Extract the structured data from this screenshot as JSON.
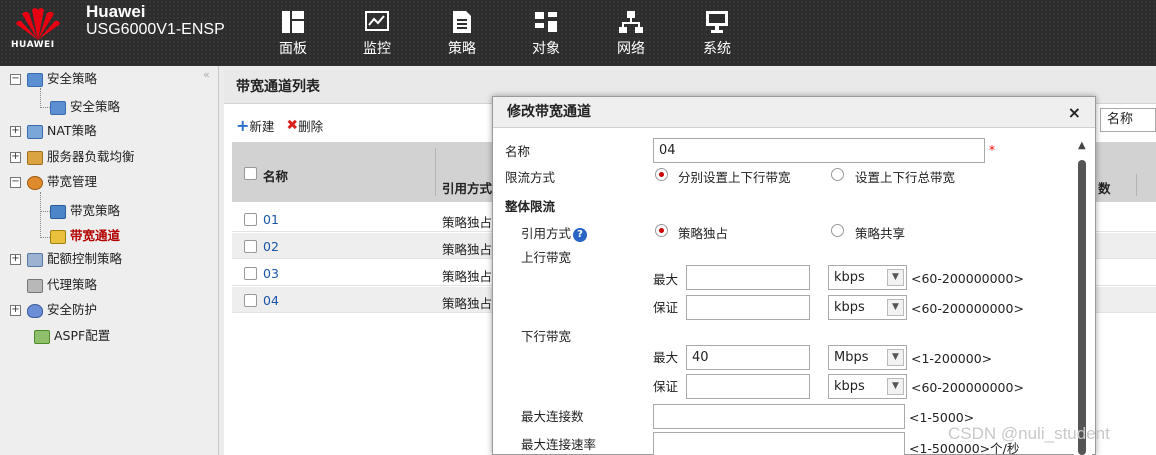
{
  "header": {
    "logo_text": "HUAWEI",
    "brand_name": "Huawei",
    "device_model": "USG6000V1-ENSP",
    "nav": [
      {
        "label": "面板",
        "icon": "dashboard-icon"
      },
      {
        "label": "监控",
        "icon": "monitor-icon"
      },
      {
        "label": "策略",
        "icon": "policy-icon"
      },
      {
        "label": "对象",
        "icon": "object-icon"
      },
      {
        "label": "网络",
        "icon": "network-icon"
      },
      {
        "label": "系统",
        "icon": "system-icon"
      }
    ]
  },
  "sidebar": {
    "collapse_glyph": "«",
    "items": [
      {
        "label": "安全策略",
        "expand": "−"
      },
      {
        "label": "安全策略"
      },
      {
        "label": "NAT策略",
        "expand": "+"
      },
      {
        "label": "服务器负载均衡",
        "expand": "+"
      },
      {
        "label": "带宽管理",
        "expand": "−"
      },
      {
        "label": "带宽策略"
      },
      {
        "label": "带宽通道"
      },
      {
        "label": "配额控制策略",
        "expand": "+"
      },
      {
        "label": "代理策略"
      },
      {
        "label": "安全防护",
        "expand": "+"
      },
      {
        "label": "ASPF配置"
      }
    ]
  },
  "main": {
    "title": "带宽通道列表",
    "new_label": "新建",
    "delete_label": "删除",
    "columns": [
      "名称",
      "引用方式"
    ],
    "rows": [
      {
        "name": "01",
        "ref": "策略独占"
      },
      {
        "name": "02",
        "ref": "策略独占"
      },
      {
        "name": "03",
        "ref": "策略独占"
      },
      {
        "name": "04",
        "ref": "策略独占"
      }
    ],
    "right_partial_col": "数",
    "search_field_label": "名称"
  },
  "dialog": {
    "title": "修改带宽通道",
    "close": "×",
    "name_label": "名称",
    "name_value": "04",
    "required_mark": "*",
    "limit_mode_label": "限流方式",
    "limit_mode_options": [
      "分别设置上下行带宽",
      "设置上下行总带宽"
    ],
    "limit_mode_selected": 0,
    "section_overall": "整体限流",
    "ref_mode_label": "引用方式",
    "ref_mode_help": "?",
    "ref_mode_options": [
      "策略独占",
      "策略共享"
    ],
    "ref_mode_selected": 0,
    "upstream_label": "上行带宽",
    "downstream_label": "下行带宽",
    "max_label": "最大",
    "guarantee_label": "保证",
    "up_max": {
      "value": "",
      "unit": "kbps",
      "range": "<60-200000000>"
    },
    "up_guarantee": {
      "value": "",
      "unit": "kbps",
      "range": "<60-200000000>"
    },
    "down_max": {
      "value": "40",
      "unit": "Mbps",
      "range": "<1-200000>"
    },
    "down_guarantee": {
      "value": "",
      "unit": "kbps",
      "range": "<60-200000000>"
    },
    "max_conn_label": "最大连接数",
    "max_conn_value": "",
    "max_conn_range": "<1-5000>",
    "max_conn_rate_label": "最大连接速率",
    "max_conn_rate_value": "",
    "max_conn_rate_range": "<1-500000>个/秒"
  },
  "watermark": "CSDN @nuli_student",
  "colors": {
    "accent_red": "#cc0000",
    "link_blue": "#1a55a6",
    "topbar": "#2d2d2d"
  }
}
